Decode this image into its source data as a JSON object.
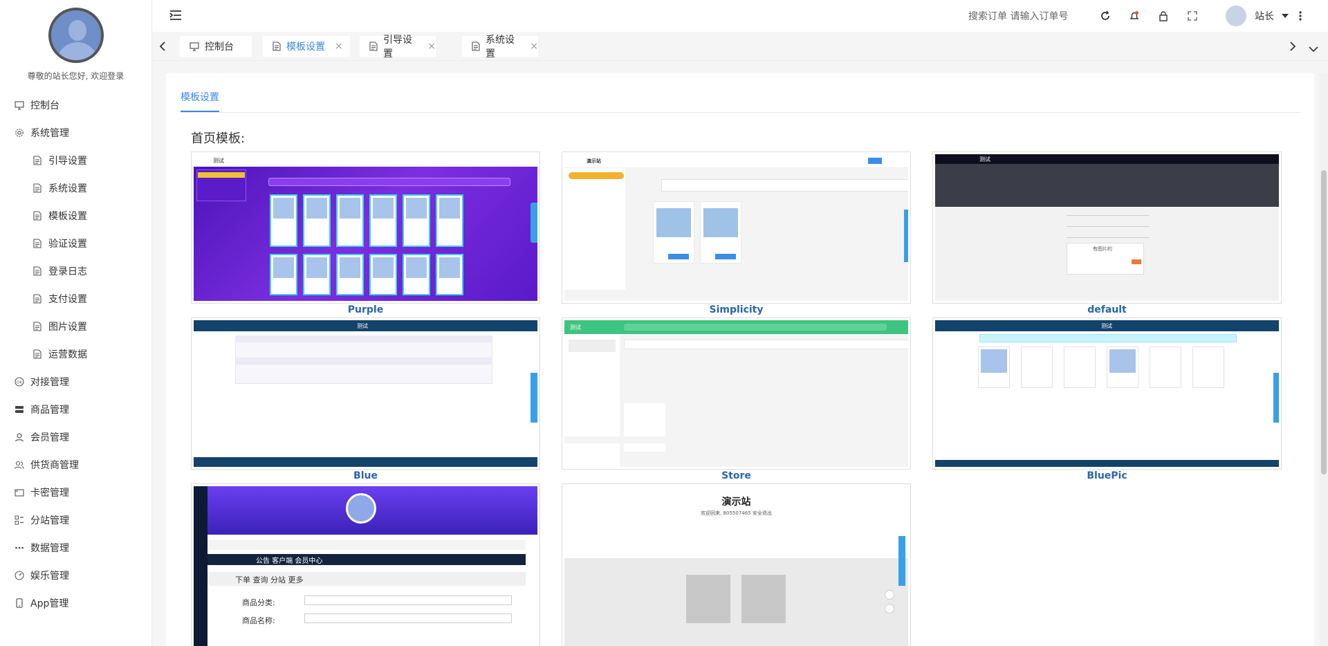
{
  "sidebar": {
    "welcome": "尊敬的站长您好, 欢迎登录",
    "items": [
      {
        "label": "控制台",
        "icon": "monitor-icon",
        "level": "top"
      },
      {
        "label": "系统管理",
        "icon": "gear-icon",
        "level": "top"
      },
      {
        "label": "引导设置",
        "icon": "document-icon",
        "level": "sub"
      },
      {
        "label": "系统设置",
        "icon": "document-icon",
        "level": "sub"
      },
      {
        "label": "模板设置",
        "icon": "document-icon",
        "level": "sub"
      },
      {
        "label": "验证设置",
        "icon": "document-icon",
        "level": "sub"
      },
      {
        "label": "登录日志",
        "icon": "document-icon",
        "level": "sub"
      },
      {
        "label": "支付设置",
        "icon": "document-icon",
        "level": "sub"
      },
      {
        "label": "图片设置",
        "icon": "document-icon",
        "level": "sub"
      },
      {
        "label": "运营数据",
        "icon": "document-icon",
        "level": "sub"
      },
      {
        "label": "对接管理",
        "icon": "ok-icon",
        "level": "top"
      },
      {
        "label": "商品管理",
        "icon": "server-icon",
        "level": "top"
      },
      {
        "label": "会员管理",
        "icon": "user-icon",
        "level": "top"
      },
      {
        "label": "供货商管理",
        "icon": "users-icon",
        "level": "top"
      },
      {
        "label": "卡密管理",
        "icon": "card-icon",
        "level": "top"
      },
      {
        "label": "分站管理",
        "icon": "apps-icon",
        "level": "top"
      },
      {
        "label": "数据管理",
        "icon": "more-icon",
        "level": "top"
      },
      {
        "label": "娱乐管理",
        "icon": "dashboard-icon",
        "level": "top"
      },
      {
        "label": "App管理",
        "icon": "phone-icon",
        "level": "top"
      }
    ]
  },
  "header": {
    "search_label": "搜索订单 请输入订单号",
    "user_name": "站长"
  },
  "tabs": [
    {
      "label": "控制台",
      "icon": "monitor-icon",
      "closable": false,
      "active": false
    },
    {
      "label": "模板设置",
      "icon": "document-icon",
      "closable": true,
      "active": true
    },
    {
      "label": "引导设置",
      "icon": "document-icon",
      "closable": true,
      "active": false
    },
    {
      "label": "系统设置",
      "icon": "document-icon",
      "closable": true,
      "active": false
    }
  ],
  "content": {
    "subtab": "模板设置",
    "section_title": "首页模板:",
    "templates": [
      {
        "name": "Purple"
      },
      {
        "name": "Simplicity"
      },
      {
        "name": "default"
      },
      {
        "name": "Blue"
      },
      {
        "name": "Store"
      },
      {
        "name": "BluePic"
      },
      {
        "name": ""
      },
      {
        "name": ""
      }
    ],
    "thumb_text": {
      "purple_site": "测试",
      "simplicity_site": "演示站",
      "default_site": "测试",
      "default_item": "有图片的",
      "blue_site": "测试",
      "store_site": "测试",
      "bluepic_site": "测试",
      "demo_site": "演示站",
      "demo_sub": "欢迎回来, 805507465 安全退出",
      "purple2_row1": "公告    客户端    会员中心",
      "purple2_row2": "下单    查询    分站    更多",
      "purple2_field1": "商品分类:",
      "purple2_field2": "商品名称:"
    }
  },
  "colors": {
    "accent": "#3b88e0",
    "purple": "#6a1fd0",
    "navy": "#12436a",
    "store_green": "#3dc47e"
  }
}
